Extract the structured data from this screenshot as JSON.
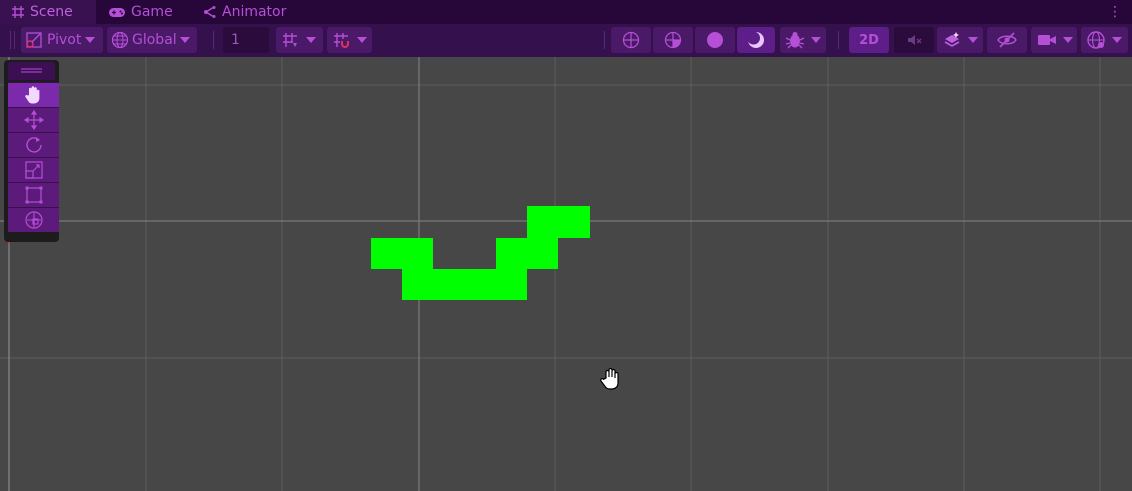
{
  "window": {
    "tabs": [
      {
        "label": "Scene",
        "icon": "grid-icon",
        "active": true
      },
      {
        "label": "Game",
        "icon": "gamepad-icon",
        "active": false
      },
      {
        "label": "Animator",
        "icon": "animator-icon",
        "active": false
      }
    ],
    "menu_icon": "kebab-menu-icon"
  },
  "toolbar": {
    "pivot_label": "Pivot",
    "global_label": "Global",
    "grid_size_value": "1",
    "mode_2d_label": "2D"
  },
  "tools": [
    {
      "name": "hand-tool",
      "icon": "hand-icon",
      "selected": true
    },
    {
      "name": "move-tool",
      "icon": "move-icon",
      "selected": false
    },
    {
      "name": "rotate-tool",
      "icon": "rotate-icon",
      "selected": false
    },
    {
      "name": "scale-tool",
      "icon": "scale-icon",
      "selected": false
    },
    {
      "name": "rect-tool",
      "icon": "rect-icon",
      "selected": false
    },
    {
      "name": "transform-tool",
      "icon": "transform-icon",
      "selected": false
    }
  ],
  "colors": {
    "accent": "#b44fd6",
    "tabbar": "#27073a",
    "toolbar": "#34104c",
    "button": "#4a1a68",
    "scene_bg": "#474747",
    "grid_line": "#5e5e5e",
    "sprite": "#00ff00"
  },
  "scene": {
    "object": "green-pixel-snake-sprite",
    "cursor": "hand-cursor-icon"
  }
}
